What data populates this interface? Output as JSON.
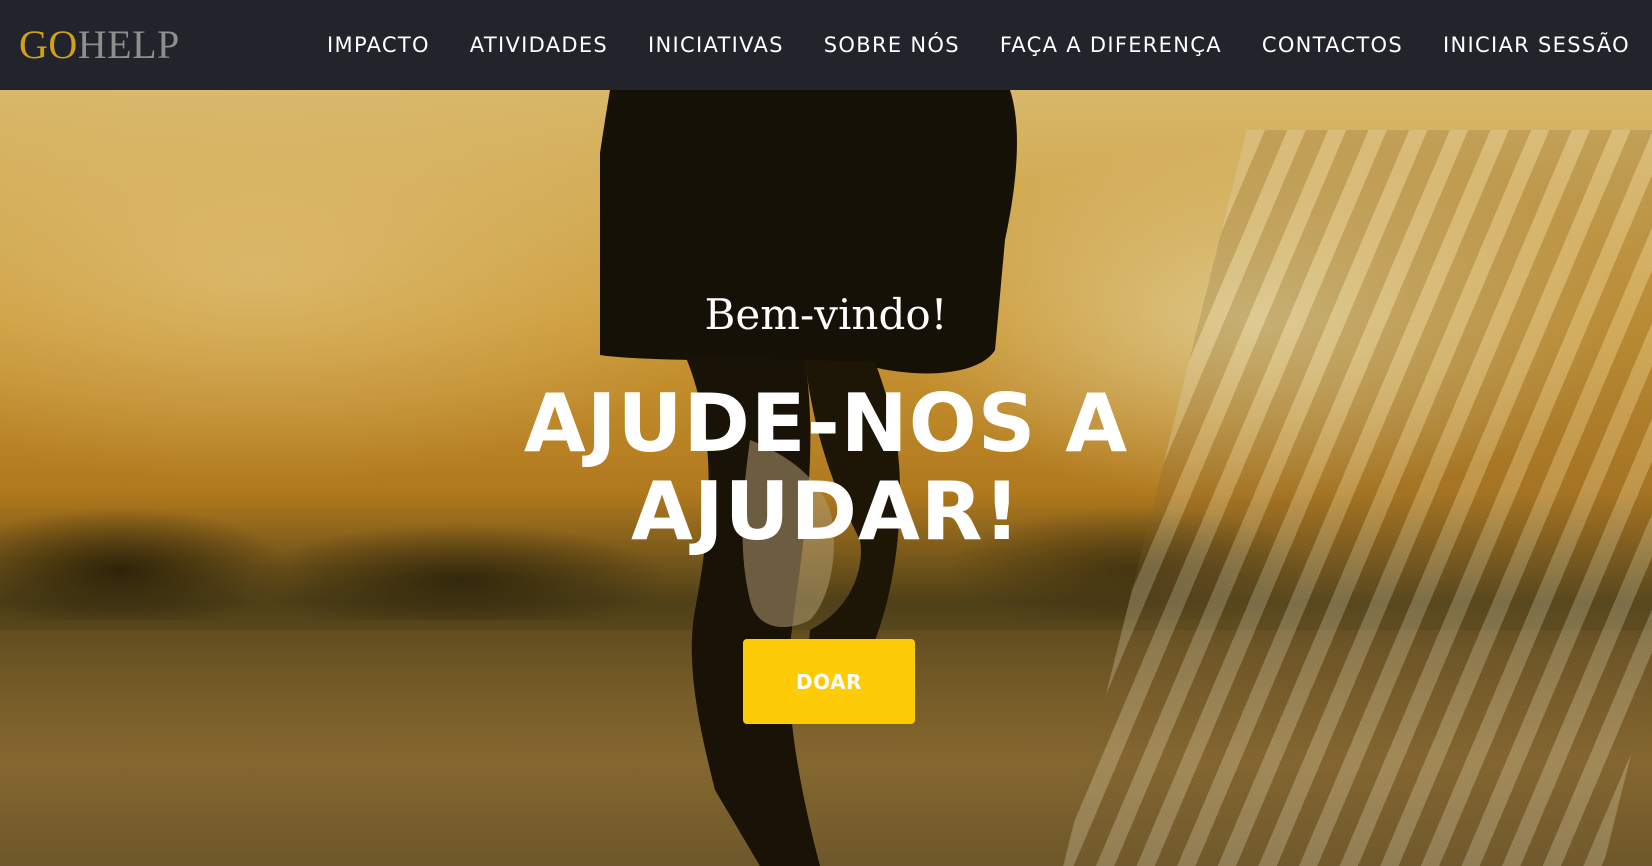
{
  "brand": {
    "part1": "GO",
    "part2": "HELP",
    "colors": {
      "go": "#d4a017",
      "help": "#8e8e8e"
    }
  },
  "nav": {
    "items": [
      {
        "label": "IMPACTO"
      },
      {
        "label": "ATIVIDADES"
      },
      {
        "label": "INICIATIVAS"
      },
      {
        "label": "SOBRE NÓS"
      },
      {
        "label": "FAÇA A DIFERENÇA"
      },
      {
        "label": "CONTACTOS"
      },
      {
        "label": "INICIAR SESSÃO"
      }
    ]
  },
  "hero": {
    "welcome": "Bem-vindo!",
    "headline": "AJUDE-NOS A AJUDAR!",
    "cta_label": "DOAR",
    "image": "runner-at-sunset",
    "colors": {
      "cta": "#fecb09",
      "navbar": "#21252b"
    }
  }
}
